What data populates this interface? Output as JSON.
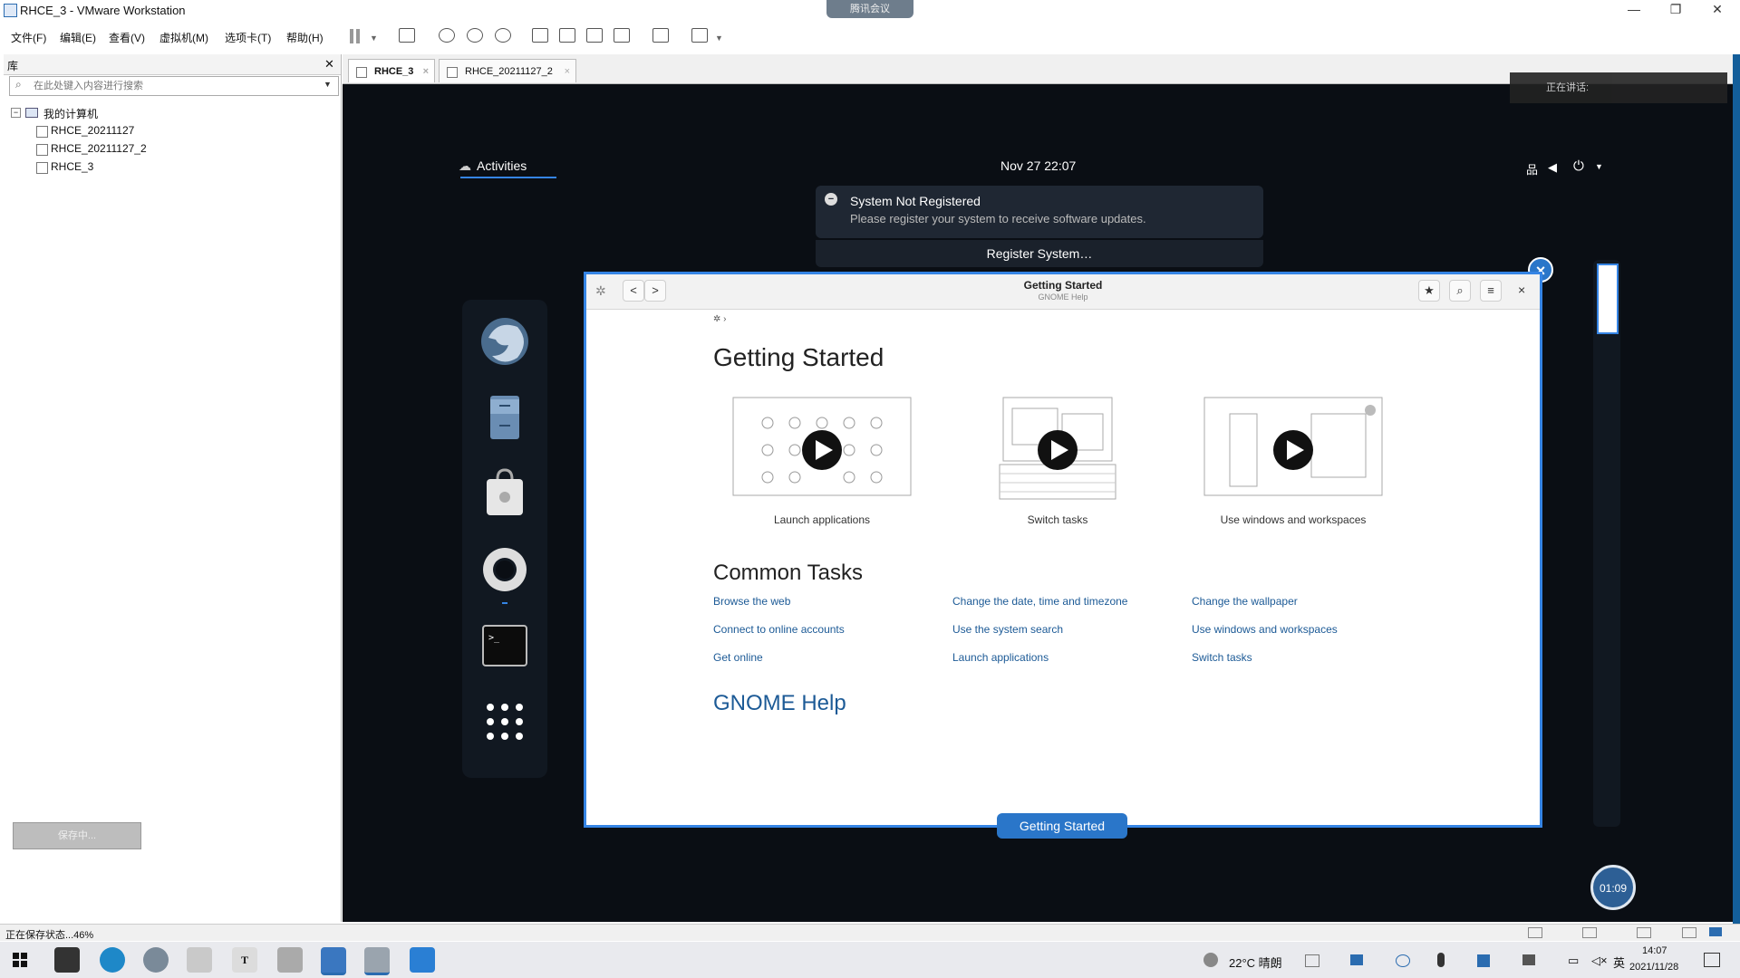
{
  "window": {
    "title": "RHCE_3 - VMware Workstation",
    "minimize": "—",
    "restore": "❐",
    "close": "✕"
  },
  "menubar": {
    "items": [
      "文件(F)",
      "编辑(E)",
      "查看(V)",
      "虚拟机(M)",
      "选项卡(T)",
      "帮助(H)"
    ]
  },
  "library": {
    "header": "库",
    "close": "✕",
    "search_placeholder": "在此处键入内容进行搜索",
    "root": "我的计算机",
    "vms": [
      "RHCE_20211127",
      "RHCE_20211127_2",
      "RHCE_3"
    ],
    "bottom_button": "保存中..."
  },
  "tabs": [
    {
      "label": "RHCE_3",
      "active": true
    },
    {
      "label": "RHCE_20211127_2",
      "active": false
    }
  ],
  "gnome": {
    "activities": "Activities",
    "clock": "Nov 27  22:07",
    "notification": {
      "title": "System Not Registered",
      "body": "Please register your system to receive software updates.",
      "action": "Register System…"
    },
    "dock_label": "Getting Started"
  },
  "help": {
    "window_title": "Getting Started",
    "window_subtitle": "GNOME Help",
    "page_title": "Getting Started",
    "videos": [
      "Launch applications",
      "Switch tasks",
      "Use windows and workspaces"
    ],
    "common_tasks_title": "Common Tasks",
    "tasks": [
      [
        "Browse the web",
        "Change the date, time and timezone",
        "Change the wallpaper"
      ],
      [
        "Connect to online accounts",
        "Use the system search",
        "Use windows and workspaces"
      ],
      [
        "Get online",
        "Launch applications",
        "Switch tasks"
      ]
    ],
    "gnome_help_link": "GNOME Help"
  },
  "overlay": {
    "badge": "正在讲话:",
    "timer": "01:09",
    "notch": "腾讯会议"
  },
  "statusbar": {
    "text": "正在保存状态...46%"
  },
  "taskbar": {
    "weather": "22°C 晴朗",
    "ime": "英",
    "time": "14:07",
    "date": "2021/11/28"
  },
  "colors": {
    "accent": "#3584e4",
    "link": "#1c5a96",
    "vm_bg": "#0a0e14"
  }
}
